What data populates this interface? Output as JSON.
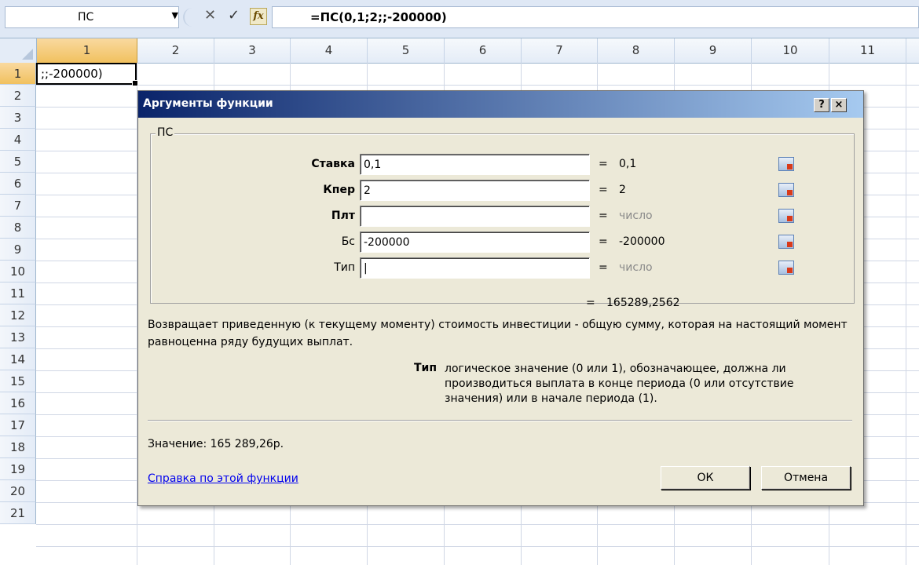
{
  "formula_bar": {
    "name_box": "ПС",
    "name_box_dropdown_icon": "chevron-down-icon",
    "formula": "=ПС(0,1;2;;-200000)",
    "fx_label": "fx"
  },
  "columns": [
    "1",
    "2",
    "3",
    "4",
    "5",
    "6",
    "7",
    "8",
    "9",
    "10",
    "11"
  ],
  "rows": [
    "1",
    "2",
    "3",
    "4",
    "5",
    "6",
    "7",
    "8",
    "9",
    "10",
    "11",
    "12",
    "13",
    "14",
    "15",
    "16",
    "17",
    "18",
    "19",
    "20",
    "21"
  ],
  "active_cell": {
    "value": ";;-200000)"
  },
  "dialog": {
    "title": "Аргументы функции",
    "help_btn": "?",
    "close_btn": "×",
    "group_legend": "ПС",
    "args": [
      {
        "label": "Ставка",
        "value": "0,1",
        "result": "0,1"
      },
      {
        "label": "Кпер",
        "value": "2",
        "result": "2"
      },
      {
        "label": "Плт",
        "value": "",
        "result": "число"
      },
      {
        "label": "Бс",
        "value": "-200000",
        "result": "-200000"
      },
      {
        "label": "Тип",
        "value": "|",
        "result": "число"
      }
    ],
    "equals": "=",
    "total_result": "165289,2562",
    "description": "Возвращает приведенную (к текущему моменту) стоимость инвестиции - общую сумму, которая на настоящий момент равноценна ряду будущих выплат.",
    "param_name": "Тип",
    "param_desc": "логическое значение (0 или 1), обозначающее, должна ли производиться выплата в конце периода (0 или отсутствие значения) или в начале периода (1).",
    "value_label": "Значение:  165 289,26р.",
    "help_link": "Справка по этой функции",
    "ok": "ОК",
    "cancel": "Отмена"
  }
}
